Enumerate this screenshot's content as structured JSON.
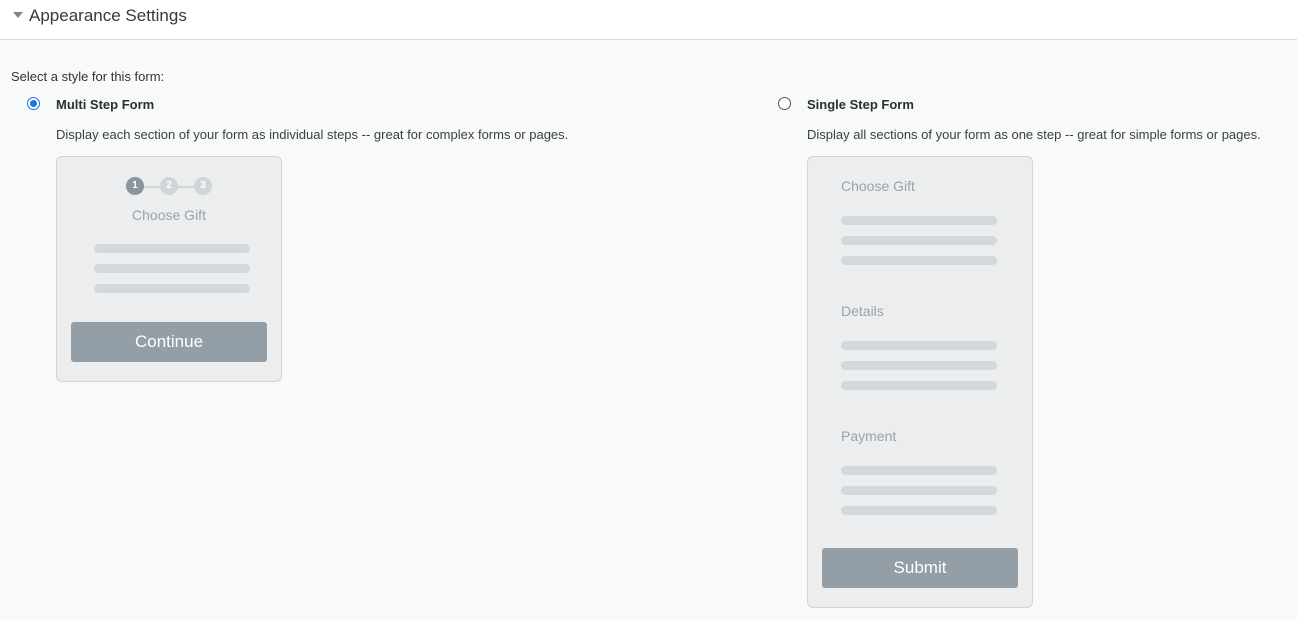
{
  "section": {
    "title": "Appearance Settings"
  },
  "prompt": "Select a style for this form:",
  "options": [
    {
      "label": "Multi Step Form",
      "selected": true,
      "description": "Display each section of your form as individual steps -- great for complex forms or pages.",
      "preview": {
        "steps": [
          "1",
          "2",
          "3"
        ],
        "heading": "Choose Gift",
        "button": "Continue"
      }
    },
    {
      "label": "Single Step Form",
      "selected": false,
      "description": "Display all sections of your form as one step -- great for simple forms or pages.",
      "preview": {
        "sections": [
          "Choose Gift",
          "Details",
          "Payment"
        ],
        "button": "Submit"
      }
    }
  ],
  "colors": {
    "radio_selected": "#1a73e8",
    "preview_button": "#939ea6",
    "preview_card": "#ebedee"
  }
}
